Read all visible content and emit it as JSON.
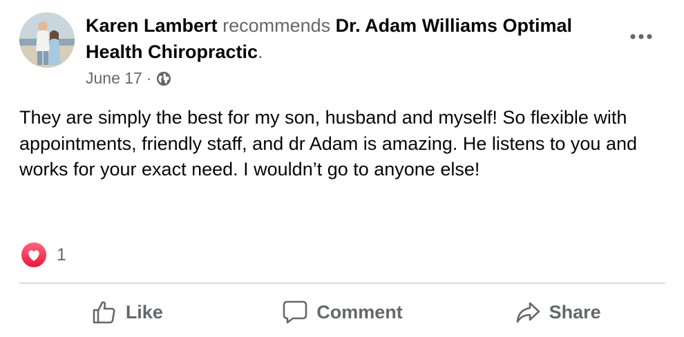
{
  "post": {
    "author": "Karen Lambert",
    "verb": "recommends",
    "page_name": "Dr. Adam Williams Optimal Health Chiropractic",
    "period": ".",
    "date": "June 17",
    "separator": "·",
    "audience_icon": "globe-icon",
    "more_icon": "more-dots-icon",
    "body": "They are simply the best for my son, husband and myself! So flexible with appointments, friendly staff, and dr Adam is amazing. He listens to you and works for your exact need. I wouldn’t go to anyone else!"
  },
  "reactions": {
    "icon": "love-reaction-icon",
    "count": "1"
  },
  "actions": {
    "like": {
      "label": "Like",
      "icon": "thumbs-up-icon"
    },
    "comment": {
      "label": "Comment",
      "icon": "comment-icon"
    },
    "share": {
      "label": "Share",
      "icon": "share-icon"
    }
  },
  "colors": {
    "text": "#050505",
    "secondary": "#65676b",
    "love_red": "#f33e58",
    "divider": "#dcdde1"
  }
}
